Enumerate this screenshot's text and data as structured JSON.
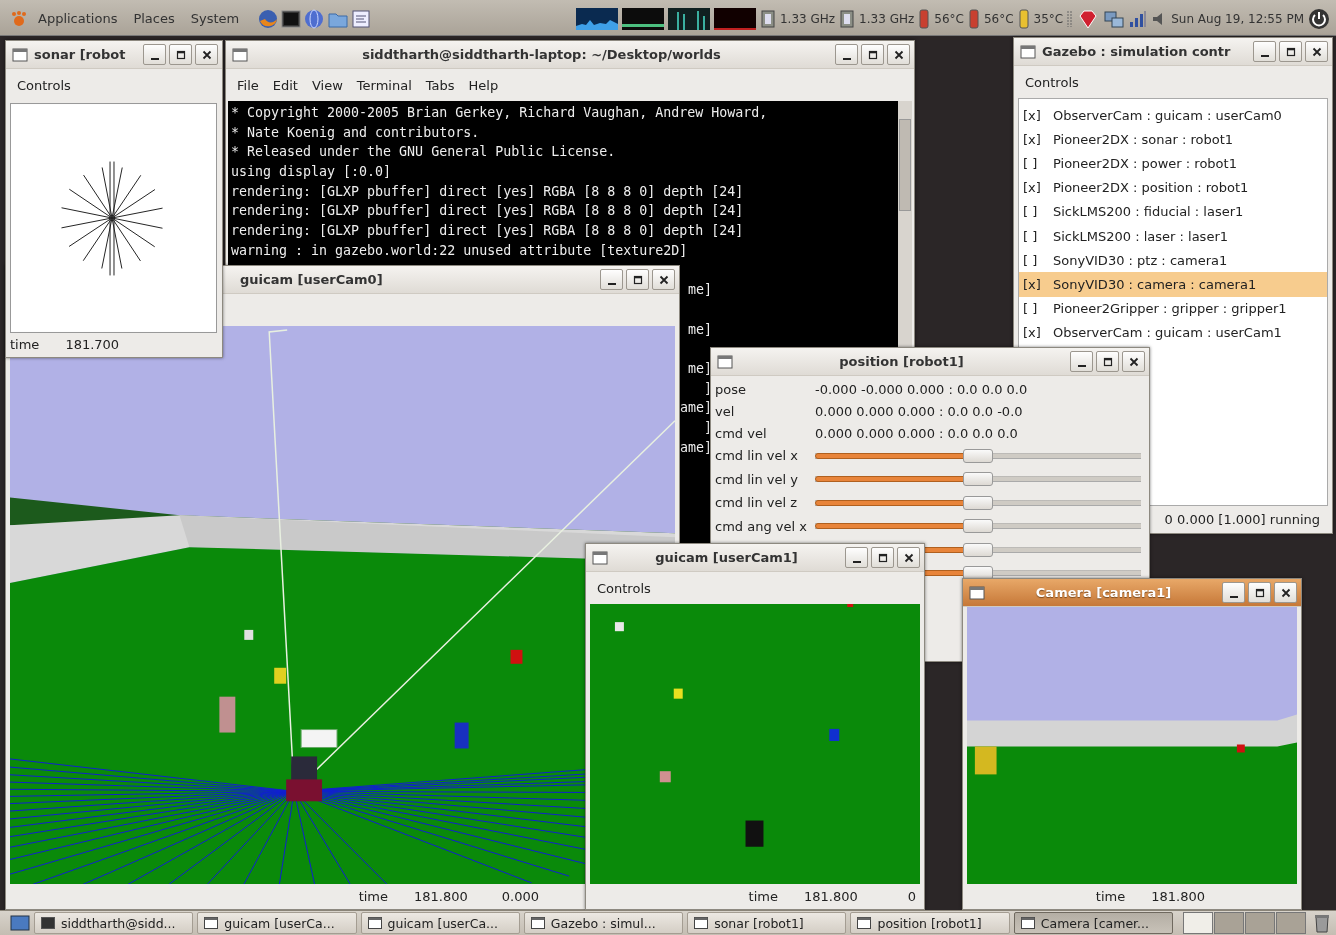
{
  "top_panel": {
    "menus": [
      "Applications",
      "Places",
      "System"
    ],
    "cpu_freqs": [
      "1.33 GHz",
      "1.33 GHz"
    ],
    "temperatures": [
      "56°C",
      "56°C",
      "35°C"
    ],
    "clock": "Sun Aug 19, 12:55 PM"
  },
  "terminal": {
    "title": "siddtharth@siddtharth-laptop: ~/Desktop/worlds",
    "menu": [
      "File",
      "Edit",
      "View",
      "Terminal",
      "Tabs",
      "Help"
    ],
    "lines": [
      {
        "kind": "full",
        "text": "* Copyright 2000-2005 Brian Gerkey, Richard Vaughan, Andrew Howard,"
      },
      {
        "kind": "full",
        "text": "* Nate Koenig and contributors."
      },
      {
        "kind": "full",
        "text": "* Released under the GNU General Public License."
      },
      {
        "kind": "full",
        "text": "using display [:0.0]"
      },
      {
        "kind": "full",
        "text": "rendering: [GLXP pbuffer] direct [yes] RGBA [8 8 8 0] depth [24]"
      },
      {
        "kind": "full",
        "text": "rendering: [GLXP pbuffer] direct [yes] RGBA [8 8 8 0] depth [24]"
      },
      {
        "kind": "full",
        "text": "rendering: [GLXP pbuffer] direct [yes] RGBA [8 8 8 0] depth [24]"
      },
      {
        "kind": "full",
        "text": "warning : in gazebo.world:22 unused attribute [texture2D]"
      },
      {
        "kind": "blank"
      },
      {
        "kind": "fragment",
        "text": "me]"
      },
      {
        "kind": "blank"
      },
      {
        "kind": "fragment",
        "text": "me]"
      },
      {
        "kind": "blank"
      },
      {
        "kind": "fragment",
        "text": "me]"
      },
      {
        "kind": "fragment",
        "text": "]"
      },
      {
        "kind": "fragment",
        "text": "ame]"
      },
      {
        "kind": "fragment",
        "text": "]"
      },
      {
        "kind": "fragment",
        "text": "ame]"
      }
    ]
  },
  "guicam_main": {
    "title": "guicam [userCam0]",
    "status": [
      "time",
      "181.800",
      "0.000"
    ]
  },
  "sonar": {
    "title": "sonar [robot",
    "menu": [
      "Controls"
    ],
    "status": [
      "time",
      "181.700"
    ]
  },
  "sim_control": {
    "title": "Gazebo : simulation contr",
    "menu": [
      "Controls"
    ],
    "items": [
      {
        "check": "[x]",
        "label": "ObserverCam : guicam : userCam0",
        "selected": false
      },
      {
        "check": "[x]",
        "label": "Pioneer2DX : sonar : robot1",
        "selected": false
      },
      {
        "check": "[ ]",
        "label": "Pioneer2DX : power : robot1",
        "selected": false
      },
      {
        "check": "[x]",
        "label": "Pioneer2DX : position : robot1",
        "selected": false
      },
      {
        "check": "[ ]",
        "label": "SickLMS200 : fiducial : laser1",
        "selected": false
      },
      {
        "check": "[ ]",
        "label": "SickLMS200 : laser : laser1",
        "selected": false
      },
      {
        "check": "[ ]",
        "label": "SonyVID30 : ptz : camera1",
        "selected": false
      },
      {
        "check": "[x]",
        "label": "SonyVID30 : camera : camera1",
        "selected": true
      },
      {
        "check": "[ ]",
        "label": "Pioneer2Gripper : gripper : gripper1",
        "selected": false
      },
      {
        "check": "[x]",
        "label": "ObserverCam : guicam : userCam1",
        "selected": false
      }
    ],
    "status": "0 0.000 [1.000] running"
  },
  "position": {
    "title": "position [robot1]",
    "readings": [
      {
        "label": "pose",
        "value": "-0.000 -0.000 0.000 : 0.0 0.0 0.0"
      },
      {
        "label": "vel",
        "value": "0.000 0.000 0.000 : 0.0 0.0 -0.0"
      },
      {
        "label": "cmd vel",
        "value": "0.000 0.000 0.000 : 0.0 0.0 0.0"
      }
    ],
    "sliders": [
      {
        "label": "cmd lin vel x",
        "level": 0.5
      },
      {
        "label": "cmd lin vel y",
        "level": 0.5
      },
      {
        "label": "cmd lin vel z",
        "level": 0.5
      },
      {
        "label": "cmd ang vel x",
        "level": 0.5
      },
      {
        "level": 0.5
      },
      {
        "level": 0.5
      }
    ]
  },
  "guicam_side": {
    "title": "guicam [userCam1]",
    "menu": [
      "Controls"
    ],
    "status": [
      "time",
      "181.800",
      "0"
    ]
  },
  "camera": {
    "title": "Camera [camera1]",
    "focused": true,
    "status": [
      "time",
      "181.800"
    ]
  },
  "taskbar": {
    "items": [
      {
        "label": "siddtharth@sidd...",
        "kind": "terminal",
        "selected": false
      },
      {
        "label": "guicam [userCa...",
        "kind": "window",
        "selected": false
      },
      {
        "label": "guicam [userCa...",
        "kind": "window",
        "selected": false
      },
      {
        "label": "Gazebo : simul...",
        "kind": "window",
        "selected": false
      },
      {
        "label": "sonar [robot1]",
        "kind": "window",
        "selected": false
      },
      {
        "label": "position [robot1]",
        "kind": "window",
        "selected": false
      },
      {
        "label": "Camera [camer...",
        "kind": "window",
        "selected": true
      }
    ]
  }
}
